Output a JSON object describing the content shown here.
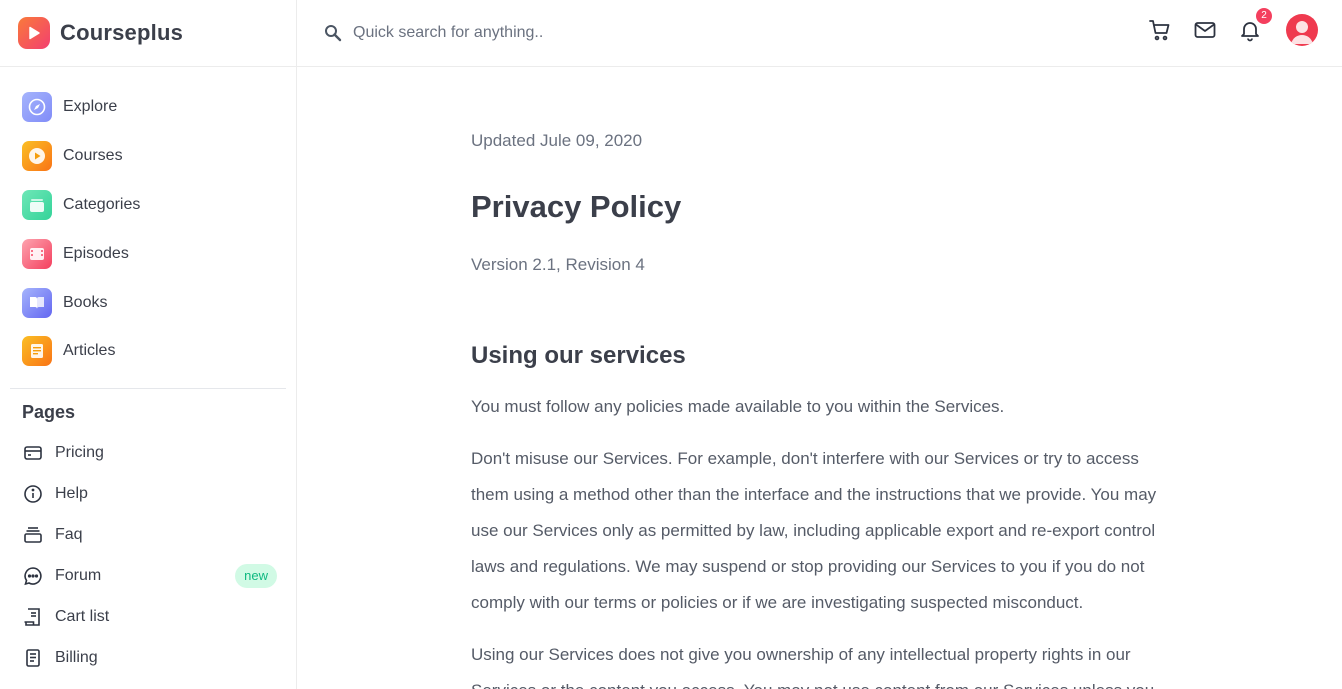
{
  "brand": {
    "name": "Courseplus"
  },
  "search": {
    "placeholder": "Quick search for anything.."
  },
  "header": {
    "icons": [
      "cart-icon",
      "mail-icon",
      "bell-icon"
    ],
    "notifications_count": "2",
    "avatar": "user-avatar"
  },
  "sidebar": {
    "items": [
      {
        "label": "Explore",
        "icon": "compass-icon",
        "color": "#8b9cf7"
      },
      {
        "label": "Courses",
        "icon": "play-icon",
        "color": "#f7a233"
      },
      {
        "label": "Categories",
        "icon": "layers-icon",
        "color": "#34d399"
      },
      {
        "label": "Episodes",
        "icon": "film-icon",
        "color": "#f87187"
      },
      {
        "label": "Books",
        "icon": "book-icon",
        "color": "#8da2fb"
      },
      {
        "label": "Articles",
        "icon": "article-icon",
        "color": "#f7a233"
      }
    ],
    "pages_title": "Pages",
    "pages": [
      {
        "label": "Pricing",
        "icon": "credit-card-icon"
      },
      {
        "label": "Help",
        "icon": "info-icon"
      },
      {
        "label": "Faq",
        "icon": "stack-icon"
      },
      {
        "label": "Forum",
        "icon": "chat-icon",
        "badge": "new"
      },
      {
        "label": "Cart list",
        "icon": "receipt-icon"
      },
      {
        "label": "Billing",
        "icon": "document-icon"
      }
    ]
  },
  "main": {
    "updated": "Updated Jule 09, 2020",
    "title": "Privacy Policy",
    "version": "Version 2.1, Revision 4",
    "section_title": "Using our services",
    "paragraphs": [
      "You must follow any policies made available to you within the Services.",
      "Don't misuse our Services. For example, don't interfere with our Services or try to access them using a method other than the interface and the instructions that we provide. You may use our Services only as permitted by law, including applicable export and re-export control laws and regulations. We may suspend or stop providing our Services to you if you do not comply with our terms or policies or if we are investigating suspected misconduct.",
      "Using our Services does not give you ownership of any intellectual property rights in our Services or the content you access. You may not use content from our Services unless you"
    ]
  },
  "colors": {
    "accent": "#f43f5e",
    "text": "#3b3f4a",
    "muted": "#6b7280",
    "new_badge_bg": "#d1fae5",
    "new_badge_text": "#10b981"
  }
}
